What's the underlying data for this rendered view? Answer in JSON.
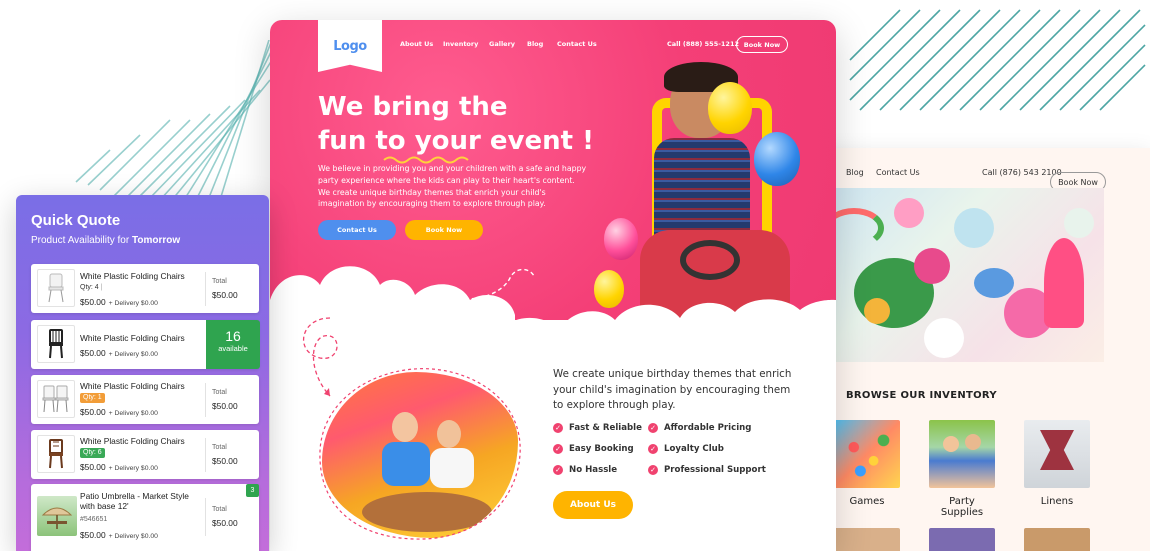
{
  "colors": {
    "brand_pink": "#f43f77",
    "button_blue": "#4f8fee",
    "button_yellow": "#ffb400",
    "available_green": "#2fa44f",
    "quote_purple": "#8d6ae3",
    "check_pink": "#f0426f"
  },
  "main_site": {
    "logo": "Logo",
    "nav": [
      "About Us",
      "Inventory",
      "Gallery",
      "Blog",
      "Contact Us"
    ],
    "phone": "Call (888) 555-1212",
    "book_now": "Book Now",
    "hero": {
      "title_line1": "We bring the",
      "title_line2": "fun to your event !",
      "paragraph": "We believe in providing you and your children with a safe and happy party experience where the kids can play to their heart's content. We create unique birthday themes that enrich your child's imagination by encouraging them to explore through play.",
      "contact_button": "Contact Us",
      "book_button": "Book Now"
    },
    "section": {
      "text": "We create unique birthday themes that enrich your child's imagination by encouraging them to explore through play.",
      "features": [
        "Fast & Reliable",
        "Affordable Pricing",
        "Easy Booking",
        "Loyalty Club",
        "No Hassle",
        "Professional Support"
      ],
      "about_button": "About Us"
    }
  },
  "secondary_site": {
    "nav": [
      "Blog",
      "Contact Us"
    ],
    "phone": "Call (876) 543 2100",
    "book_now": "Book Now",
    "inventory_title": "BROWSE OUR INVENTORY",
    "categories": [
      "Games",
      "Party Supplies",
      "Linens"
    ]
  },
  "quick_quote": {
    "title": "Quick Quote",
    "subtitle_prefix": "Product Availability for",
    "subtitle_day": "Tomorrow",
    "total_label": "Total",
    "items": [
      {
        "name": "White Plastic Folding Chairs",
        "qty": "Qty: 4",
        "price": "$50.00",
        "delivery": "+ Delivery $0.00",
        "total": "$50.00"
      },
      {
        "name": "White Plastic Folding Chairs",
        "price": "$50.00",
        "delivery": "+ Delivery $0.00",
        "available_count": "16",
        "available_label": "available"
      },
      {
        "name": "White Plastic Folding Chairs",
        "qty": "Qty: 1",
        "price": "$50.00",
        "delivery": "+ Delivery $0.00",
        "total": "$50.00"
      },
      {
        "name": "White Plastic Folding Chairs",
        "qty": "Qty: 6",
        "price": "$50.00",
        "delivery": "+ Delivery $0.00",
        "total": "$50.00"
      },
      {
        "name_line1": "Patio Umbrella - Market Style",
        "name_line2": "with base 12'",
        "sku": "#546651",
        "price": "$50.00",
        "delivery": "+ Delivery $0.00",
        "total": "$50.00",
        "badge": "3"
      }
    ]
  }
}
